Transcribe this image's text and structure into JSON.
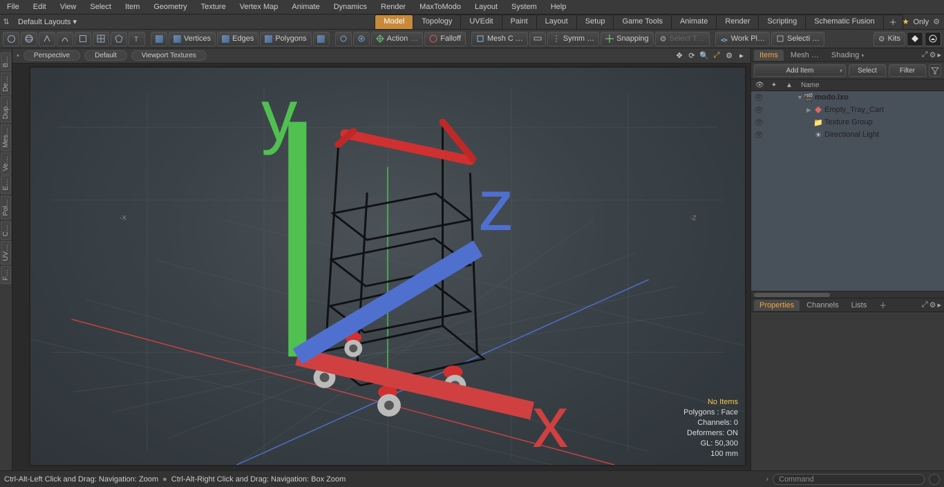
{
  "menubar": [
    "File",
    "Edit",
    "View",
    "Select",
    "Item",
    "Geometry",
    "Texture",
    "Vertex Map",
    "Animate",
    "Dynamics",
    "Render",
    "MaxToModo",
    "Layout",
    "System",
    "Help"
  ],
  "layout_dropdown": "Default Layouts ▾",
  "layout_tabs": [
    "Model",
    "Topology",
    "UVEdit",
    "Paint",
    "Layout",
    "Setup",
    "Game Tools",
    "Animate",
    "Render",
    "Scripting",
    "Schematic Fusion"
  ],
  "layout_active": 0,
  "layout_only": "Only",
  "toolbar": {
    "sel_modes": [
      "Vertices",
      "Edges",
      "Polygons"
    ],
    "action": "Action",
    "falloff": "Falloff",
    "meshc": "Mesh C …",
    "symm": "Symm …",
    "snapping": "Snapping",
    "select_t": "Select T…",
    "workpl": "Work Pl…",
    "selecti": "Selecti …",
    "kits": "Kits"
  },
  "viewport_tabs": [
    "Perspective",
    "Default",
    "Viewport Textures"
  ],
  "axis_labels": {
    "x": "-X",
    "z": "-Z"
  },
  "vpstats": {
    "warn": "No Items",
    "lines": [
      "Polygons : Face",
      "Channels: 0",
      "Deformers: ON",
      "GL: 50,300",
      "100 mm"
    ]
  },
  "gizmo": {
    "x": "x",
    "y": "y",
    "z": "z"
  },
  "rightpanel": {
    "top_tabs": [
      "Items",
      "Mesh …",
      "Shading"
    ],
    "top_active": 0,
    "add_item": "Add Item",
    "select_btn": "Select",
    "filter_btn": "Filter",
    "tree_header": "Name",
    "tree": [
      {
        "indent": 0,
        "bold": true,
        "twisty": "▼",
        "icon": "scene",
        "label": "modo.lxo"
      },
      {
        "indent": 1,
        "bold": false,
        "twisty": "▶",
        "icon": "mesh",
        "label": "Empty_Tray_Cart"
      },
      {
        "indent": 1,
        "bold": false,
        "twisty": "",
        "icon": "group",
        "label": "Texture Group"
      },
      {
        "indent": 1,
        "bold": false,
        "twisty": "",
        "icon": "light",
        "label": "Directional Light"
      }
    ],
    "bottom_tabs": [
      "Properties",
      "Channels",
      "Lists"
    ],
    "bottom_active": 0
  },
  "left_tabs": [
    "B…",
    "De…",
    "Dup…",
    "Mes…",
    "Ve…",
    "E…",
    "Pol…",
    "C…",
    "UV…",
    "F…"
  ],
  "statusbar": {
    "left1": "Ctrl-Alt-Left Click and Drag: Navigation: Zoom",
    "left2": "Ctrl-Alt-Right Click and Drag: Navigation: Box Zoom",
    "command_placeholder": "Command"
  }
}
